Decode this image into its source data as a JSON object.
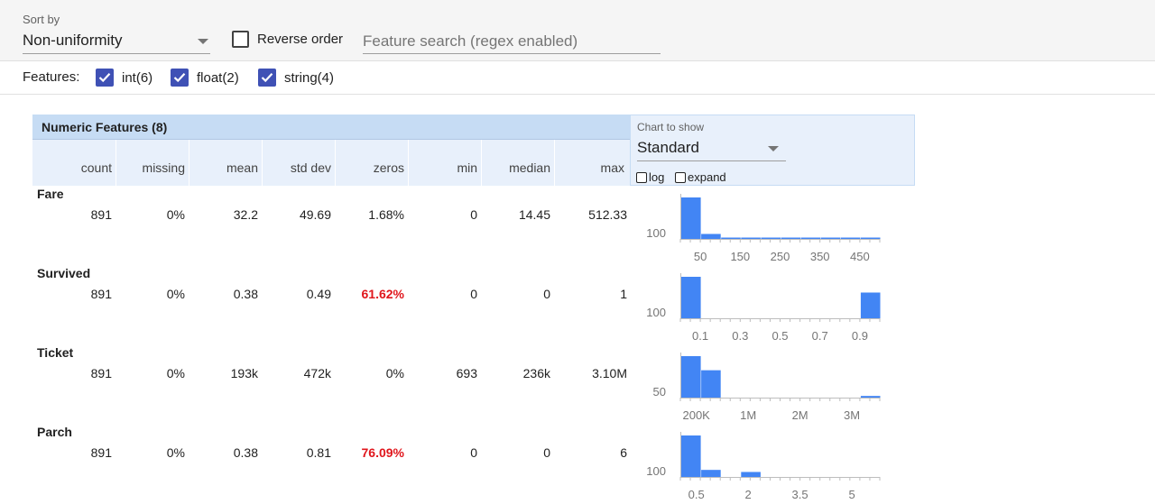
{
  "controls": {
    "sort_label": "Sort by",
    "sort_value": "Non-uniformity",
    "reverse_label": "Reverse order",
    "search_placeholder": "Feature search (regex enabled)"
  },
  "features_filter": {
    "label": "Features:",
    "items": [
      {
        "label": "int(6)",
        "checked": true
      },
      {
        "label": "float(2)",
        "checked": true
      },
      {
        "label": "string(4)",
        "checked": true
      }
    ]
  },
  "table": {
    "title": "Numeric Features (8)",
    "columns": [
      "count",
      "missing",
      "mean",
      "std dev",
      "zeros",
      "min",
      "median",
      "max"
    ]
  },
  "chart_panel": {
    "label": "Chart to show",
    "value": "Standard",
    "log_label": "log",
    "expand_label": "expand"
  },
  "colors": {
    "bar": "#4285f4",
    "highlight": "#e0161c",
    "header_bg": "#c6dcf4",
    "checkbox": "#3f51b5"
  },
  "rows": [
    {
      "name": "Fare",
      "values": [
        "891",
        "0%",
        "32.2",
        "49.69",
        "1.68%",
        "0",
        "14.45",
        "512.33"
      ],
      "zeros_highlight": false,
      "hist": {
        "ylabel": "100",
        "ticks": [
          "50",
          "150",
          "250",
          "350",
          "450"
        ],
        "bins": [
          1.0,
          0.12,
          0.03,
          0.01,
          0.01,
          0.005,
          0.005,
          0.005,
          0.003,
          0.003
        ]
      }
    },
    {
      "name": "Survived",
      "values": [
        "891",
        "0%",
        "0.38",
        "0.49",
        "61.62%",
        "0",
        "0",
        "1"
      ],
      "zeros_highlight": true,
      "hist": {
        "ylabel": "100",
        "ticks": [
          "0.1",
          "0.3",
          "0.5",
          "0.7",
          "0.9"
        ],
        "bins": [
          1.0,
          0,
          0,
          0,
          0,
          0,
          0,
          0,
          0,
          0.62
        ]
      }
    },
    {
      "name": "Ticket",
      "values": [
        "891",
        "0%",
        "193k",
        "472k",
        "0%",
        "693",
        "236k",
        "3.10M"
      ],
      "zeros_highlight": false,
      "hist": {
        "ylabel": "50",
        "ticks": [
          "200K",
          "1M",
          "2M",
          "3M"
        ],
        "bins": [
          1.0,
          0.66,
          0,
          0,
          0,
          0,
          0,
          0,
          0,
          0.04
        ]
      }
    },
    {
      "name": "Parch",
      "values": [
        "891",
        "0%",
        "0.38",
        "0.81",
        "76.09%",
        "0",
        "0",
        "6"
      ],
      "zeros_highlight": true,
      "hist": {
        "ylabel": "100",
        "ticks": [
          "0.5",
          "2",
          "3.5",
          "5"
        ],
        "bins": [
          1.0,
          0.17,
          0,
          0.12,
          0,
          0,
          0,
          0,
          0,
          0
        ]
      }
    }
  ]
}
